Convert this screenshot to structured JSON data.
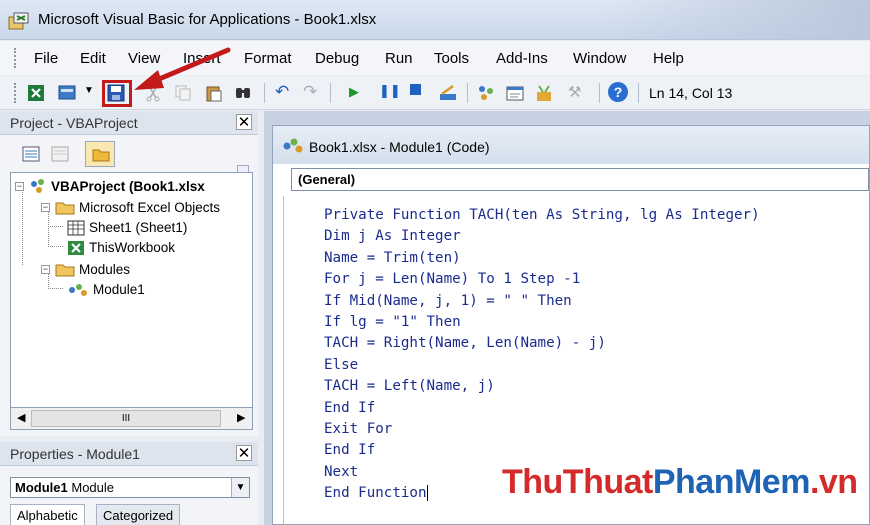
{
  "window": {
    "title": "Microsoft Visual Basic for Applications - Book1.xlsx"
  },
  "menu": [
    {
      "label": "File"
    },
    {
      "label": "Edit"
    },
    {
      "label": "View"
    },
    {
      "label": "Insert"
    },
    {
      "label": "Format"
    },
    {
      "label": "Debug"
    },
    {
      "label": "Run"
    },
    {
      "label": "Tools"
    },
    {
      "label": "Add-Ins"
    },
    {
      "label": "Window"
    },
    {
      "label": "Help"
    }
  ],
  "toolbar": {
    "position_label": "Ln 14, Col 13",
    "icons": [
      "excel-view-icon",
      "insert-module-icon",
      "save-icon",
      "cut-icon",
      "copy-icon",
      "paste-icon",
      "find-icon",
      "undo-icon",
      "redo-icon",
      "run-icon",
      "break-icon",
      "reset-icon",
      "design-mode-icon",
      "project-explorer-icon",
      "properties-icon",
      "object-browser-icon",
      "toolbox-icon",
      "help-icon"
    ]
  },
  "project_pane": {
    "title": "Project - VBAProject",
    "close": "✕",
    "tree": {
      "root": "VBAProject (Book1.xlsx",
      "excel_objects": "Microsoft Excel Objects",
      "sheet1": "Sheet1 (Sheet1)",
      "thisworkbook": "ThisWorkbook",
      "modules": "Modules",
      "module1": "Module1"
    },
    "scroll_mid": "III"
  },
  "properties_pane": {
    "title": "Properties - Module1",
    "close": "✕",
    "object_name": "Module1",
    "object_type": "Module",
    "tabs": [
      {
        "label": "Alphabetic"
      },
      {
        "label": "Categorized"
      }
    ]
  },
  "code_window": {
    "title": "Book1.xlsx - Module1 (Code)",
    "object_dropdown": "(General)",
    "lines": [
      "Private Function TACH(ten As String, lg As Integer)",
      "Dim j As Integer",
      "Name = Trim(ten)",
      "For j = Len(Name) To 1 Step -1",
      "If Mid(Name, j, 1) = \" \" Then",
      "If lg = \"1\" Then",
      "TACH = Right(Name, Len(Name) - j)",
      "Else",
      "TACH = Left(Name, j)",
      "End If",
      "Exit For",
      "End If",
      "Next",
      "End Function"
    ]
  },
  "watermark": {
    "part1": "ThuThuat",
    "part2": "PhanMem",
    "part3": ".vn"
  },
  "colors": {
    "code_text": "#1b2c8f",
    "highlight": "#c21a1a",
    "watermark_red": "#d42a2a",
    "watermark_blue": "#1e63b4"
  }
}
